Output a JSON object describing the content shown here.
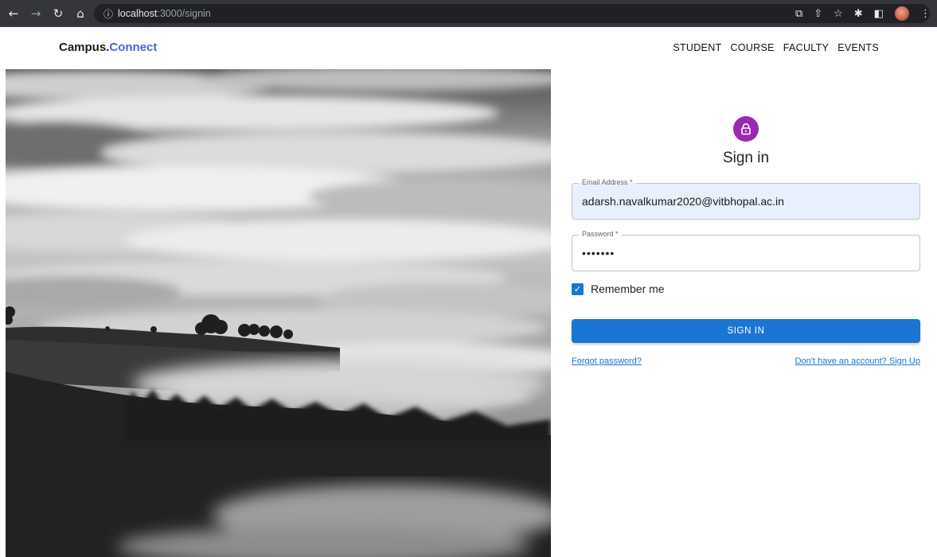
{
  "browser": {
    "url_host": "localhost",
    "url_path": ":3000/signin",
    "icons": [
      "back-icon",
      "forward-icon",
      "reload-icon",
      "home-icon",
      "info-icon",
      "screen-share-icon",
      "share-icon",
      "star-icon",
      "extensions-icon",
      "sidepanel-icon",
      "avatar",
      "menu-icon"
    ]
  },
  "appbar": {
    "brand_main": "Campus.",
    "brand_accent": "Connect",
    "nav": [
      {
        "label": "STUDENT"
      },
      {
        "label": "COURSE"
      },
      {
        "label": "FACULTY"
      },
      {
        "label": "EVENTS"
      }
    ]
  },
  "signin": {
    "title": "Sign in",
    "email_label": "Email Address *",
    "email_value": "adarsh.navalkumar2020@vitbhopal.ac.in",
    "password_label": "Password *",
    "password_value": "•••••••",
    "remember_label": "Remember me",
    "remember_checked": true,
    "button_label": "SIGN IN",
    "forgot_link": "Forgot password?",
    "signup_link": "Don't have an account? Sign Up"
  },
  "colors": {
    "primary": "#1976d2",
    "avatar_purple": "#9c27b0",
    "brand_accent": "#4b63d6",
    "autofill_bg": "#e8f0fe"
  }
}
